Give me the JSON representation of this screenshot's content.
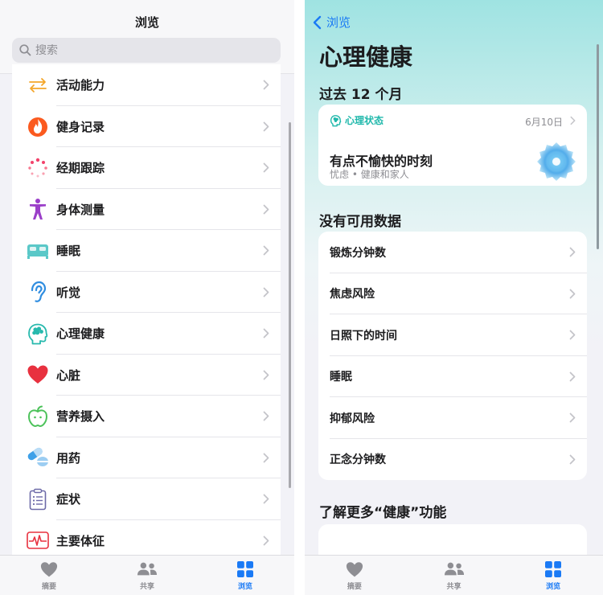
{
  "left": {
    "title": "浏览",
    "search": {
      "placeholder": "搜索"
    },
    "categories": [
      {
        "label": "活动能力",
        "icon": "mobility-arrows-icon"
      },
      {
        "label": "健身记录",
        "icon": "flame-icon"
      },
      {
        "label": "经期跟踪",
        "icon": "cycle-dots-icon"
      },
      {
        "label": "身体测量",
        "icon": "body-figure-icon"
      },
      {
        "label": "睡眠",
        "icon": "bed-icon"
      },
      {
        "label": "听觉",
        "icon": "ear-icon"
      },
      {
        "label": "心理健康",
        "icon": "mind-head-icon"
      },
      {
        "label": "心脏",
        "icon": "heart-icon"
      },
      {
        "label": "营养摄入",
        "icon": "apple-icon"
      },
      {
        "label": "用药",
        "icon": "pills-icon"
      },
      {
        "label": "症状",
        "icon": "clipboard-icon"
      },
      {
        "label": "主要体征",
        "icon": "vitals-waveform-icon"
      }
    ]
  },
  "tabs": [
    {
      "label": "摘要",
      "icon": "heart-summary-icon"
    },
    {
      "label": "共享",
      "icon": "people-icon"
    },
    {
      "label": "浏览",
      "icon": "grid-icon",
      "active": true
    }
  ],
  "right": {
    "back_label": "浏览",
    "title": "心理健康",
    "section_past": "过去 12 个月",
    "card": {
      "category": "心理状态",
      "date": "6月10日",
      "main": "有点不愉快的时刻",
      "sub": "忧虑 • 健康和家人"
    },
    "section_none": "没有可用数据",
    "items": [
      "锻炼分钟数",
      "焦虑风险",
      "日照下的时间",
      "睡眠",
      "抑郁风险",
      "正念分钟数"
    ],
    "section_more": "了解更多“健康”功能"
  },
  "colors": {
    "accent": "#1a7af5",
    "teal": "#1fb8ab",
    "heart": "#e8313f",
    "orange": "#f4a62a"
  }
}
